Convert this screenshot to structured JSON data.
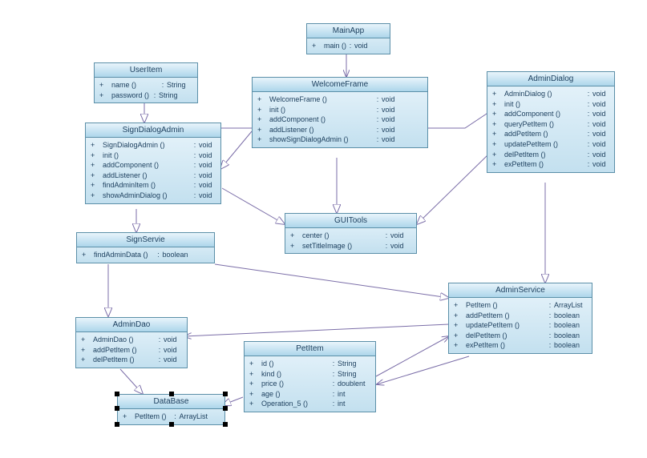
{
  "classes": {
    "MainApp": {
      "title": "MainApp",
      "methods": [
        {
          "vis": "+",
          "name": "main ()",
          "ret": "void"
        }
      ]
    },
    "UserItem": {
      "title": "UserItem",
      "methods": [
        {
          "vis": "+",
          "name": "name ()",
          "ret": "String"
        },
        {
          "vis": "+",
          "name": "password ()",
          "ret": "String"
        }
      ]
    },
    "WelcomeFrame": {
      "title": "WelcomeFrame",
      "methods": [
        {
          "vis": "+",
          "name": "WelcomeFrame ()",
          "ret": "void"
        },
        {
          "vis": "+",
          "name": "init ()",
          "ret": "void"
        },
        {
          "vis": "+",
          "name": "addComponent ()",
          "ret": "void"
        },
        {
          "vis": "+",
          "name": "addListener ()",
          "ret": "void"
        },
        {
          "vis": "+",
          "name": "showSignDialogAdmin ()",
          "ret": "void"
        }
      ]
    },
    "AdminDialog": {
      "title": "AdminDialog",
      "methods": [
        {
          "vis": "+",
          "name": "AdminDialog ()",
          "ret": "void"
        },
        {
          "vis": "+",
          "name": "init ()",
          "ret": "void"
        },
        {
          "vis": "+",
          "name": "addComponent ()",
          "ret": "void"
        },
        {
          "vis": "+",
          "name": "queryPetItem ()",
          "ret": "void"
        },
        {
          "vis": "+",
          "name": "addPetItem ()",
          "ret": "void"
        },
        {
          "vis": "+",
          "name": "updatePetItem ()",
          "ret": "void"
        },
        {
          "vis": "+",
          "name": "delPetItem ()",
          "ret": "void"
        },
        {
          "vis": "+",
          "name": "exPetItem ()",
          "ret": "void"
        }
      ]
    },
    "SignDialogAdmin": {
      "title": "SignDialogAdmin",
      "methods": [
        {
          "vis": "+",
          "name": "SignDialogAdmin ()",
          "ret": "void"
        },
        {
          "vis": "+",
          "name": "init ()",
          "ret": "void"
        },
        {
          "vis": "+",
          "name": "addComponent ()",
          "ret": "void"
        },
        {
          "vis": "+",
          "name": "addListener ()",
          "ret": "void"
        },
        {
          "vis": "+",
          "name": "findAdminItem ()",
          "ret": "void"
        },
        {
          "vis": "+",
          "name": "showAdminDialog ()",
          "ret": "void"
        }
      ]
    },
    "GUITools": {
      "title": "GUITools",
      "methods": [
        {
          "vis": "+",
          "name": "center ()",
          "ret": "void"
        },
        {
          "vis": "+",
          "name": "setTitleImage ()",
          "ret": "void"
        }
      ]
    },
    "SignServie": {
      "title": "SignServie",
      "methods": [
        {
          "vis": "+",
          "name": "findAdminData ()",
          "ret": "boolean"
        }
      ]
    },
    "AdminService": {
      "title": "AdminService",
      "methods": [
        {
          "vis": "+",
          "name": "PetItem ()",
          "ret": "ArrayList"
        },
        {
          "vis": "+",
          "name": "addPetItem ()",
          "ret": "boolean"
        },
        {
          "vis": "+",
          "name": "updatePetItem ()",
          "ret": "boolean"
        },
        {
          "vis": "+",
          "name": "delPetItem ()",
          "ret": "boolean"
        },
        {
          "vis": "+",
          "name": "exPetItem ()",
          "ret": "boolean"
        }
      ]
    },
    "AdminDao": {
      "title": "AdminDao",
      "methods": [
        {
          "vis": "+",
          "name": "AdminDao ()",
          "ret": "void"
        },
        {
          "vis": "+",
          "name": "addPetItem ()",
          "ret": "void"
        },
        {
          "vis": "+",
          "name": "delPetItem ()",
          "ret": "void"
        }
      ]
    },
    "PetItem": {
      "title": "PetItem",
      "methods": [
        {
          "vis": "+",
          "name": "id ()",
          "ret": "String"
        },
        {
          "vis": "+",
          "name": "kind ()",
          "ret": "String"
        },
        {
          "vis": "+",
          "name": "price ()",
          "ret": "doublent"
        },
        {
          "vis": "+",
          "name": "age ()",
          "ret": "int"
        },
        {
          "vis": "+",
          "name": "Operation_5 ()",
          "ret": "int"
        }
      ]
    },
    "DataBase": {
      "title": "DataBase",
      "methods": [
        {
          "vis": "+",
          "name": "PetItem ()",
          "ret": "ArrayList"
        }
      ]
    }
  }
}
